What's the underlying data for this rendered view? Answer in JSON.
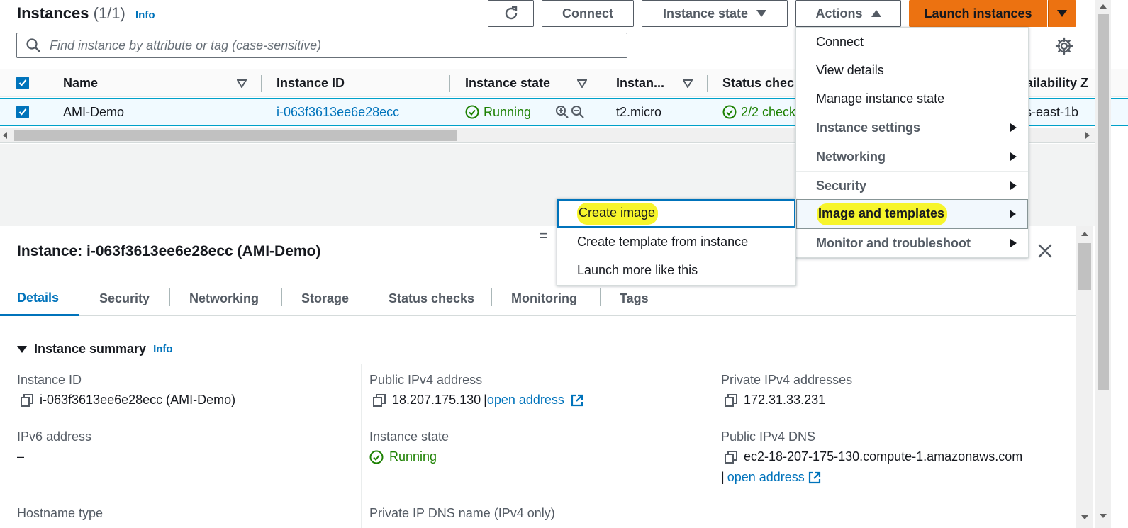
{
  "header": {
    "title": "Instances",
    "count": "(1/1)",
    "info": "Info",
    "connect": "Connect",
    "instance_state": "Instance state",
    "actions": "Actions",
    "launch": "Launch instances"
  },
  "search": {
    "placeholder": "Find instance by attribute or tag (case-sensitive)"
  },
  "table": {
    "columns": [
      "Name",
      "Instance ID",
      "Instance state",
      "Instan...",
      "Status check",
      "vailability Z"
    ],
    "row": {
      "name": "AMI-Demo",
      "id": "i-063f3613ee6e28ecc",
      "state": "Running",
      "type": "t2.micro",
      "status": "2/2 check",
      "az": "s-east-1b"
    }
  },
  "actions_menu": {
    "items": [
      "Connect",
      "View details",
      "Manage instance state",
      "Instance settings",
      "Networking",
      "Security",
      "Image and templates",
      "Monitor and troubleshoot"
    ]
  },
  "submenu": {
    "items": [
      "Create image",
      "Create template from instance",
      "Launch more like this"
    ]
  },
  "pane": {
    "title": "Instance: i-063f3613ee6e28ecc (AMI-Demo)",
    "tabs": [
      "Details",
      "Security",
      "Networking",
      "Storage",
      "Status checks",
      "Monitoring",
      "Tags"
    ],
    "summary": "Instance summary",
    "info": "Info",
    "fields": {
      "instance_id_label": "Instance ID",
      "instance_id_value": "i-063f3613ee6e28ecc (AMI-Demo)",
      "public_ipv4_label": "Public IPv4 address",
      "public_ipv4_value": "18.207.175.130",
      "open_address": "open address",
      "private_ipv4_label": "Private IPv4 addresses",
      "private_ipv4_value": "172.31.33.231",
      "ipv6_label": "IPv6 address",
      "ipv6_value": "–",
      "state_label": "Instance state",
      "state_value": "Running",
      "public_dns_label": "Public IPv4 DNS",
      "public_dns_value": "ec2-18-207-175-130.compute-1.amazonaws.com",
      "hostname_label": "Hostname type",
      "private_dns_label": "Private IP DNS name (IPv4 only)"
    }
  },
  "colors": {
    "accent": "#0073bb",
    "primary_button": "#ec7211",
    "success": "#1d8102",
    "highlight": "#f7f52c"
  }
}
